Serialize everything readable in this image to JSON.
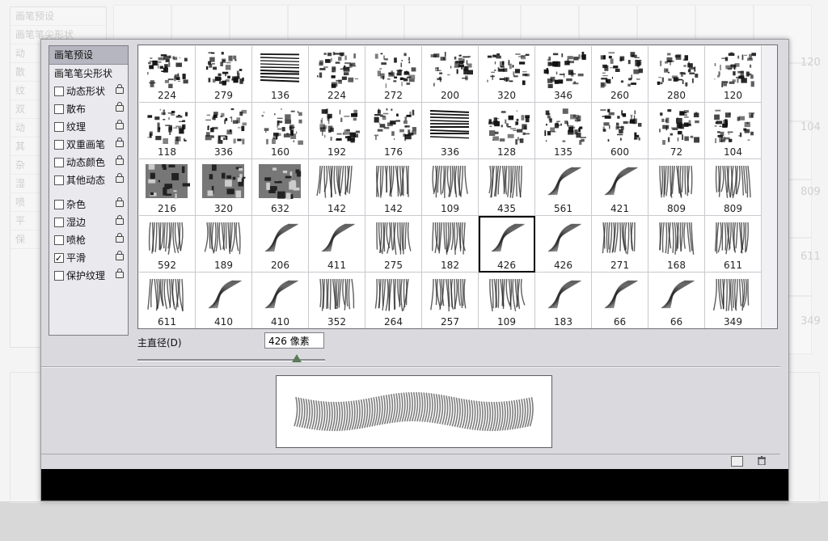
{
  "background": {
    "side_items": [
      "画笔预设",
      "画笔笔尖形状",
      "动",
      "散",
      "纹",
      "双",
      "动",
      "其",
      "杂",
      "湿",
      "喷",
      "平",
      "保"
    ],
    "right_numbers": [
      "120",
      "104",
      "809",
      "611",
      "349"
    ]
  },
  "sidebar": {
    "header": "画笔预设",
    "tip_shape": "画笔笔尖形状",
    "items": [
      {
        "label": "动态形状",
        "checked": false,
        "locked": true
      },
      {
        "label": "散布",
        "checked": false,
        "locked": true
      },
      {
        "label": "纹理",
        "checked": false,
        "locked": true
      },
      {
        "label": "双重画笔",
        "checked": false,
        "locked": true
      },
      {
        "label": "动态颜色",
        "checked": false,
        "locked": true
      },
      {
        "label": "其他动态",
        "checked": false,
        "locked": true
      },
      {
        "label": "杂色",
        "checked": false,
        "locked": true
      },
      {
        "label": "湿边",
        "checked": false,
        "locked": true
      },
      {
        "label": "喷枪",
        "checked": false,
        "locked": true
      },
      {
        "label": "平滑",
        "checked": true,
        "locked": true
      },
      {
        "label": "保护纹理",
        "checked": false,
        "locked": true
      }
    ]
  },
  "brush_grid": {
    "rows": [
      [
        {
          "size": "224",
          "kind": "grunge"
        },
        {
          "size": "279",
          "kind": "grunge"
        },
        {
          "size": "136",
          "kind": "lines"
        },
        {
          "size": "224",
          "kind": "grunge"
        },
        {
          "size": "272",
          "kind": "grunge"
        },
        {
          "size": "200",
          "kind": "grunge"
        },
        {
          "size": "320",
          "kind": "grunge"
        },
        {
          "size": "346",
          "kind": "grunge"
        },
        {
          "size": "260",
          "kind": "grunge"
        },
        {
          "size": "280",
          "kind": "grunge"
        },
        {
          "size": "120",
          "kind": "grunge"
        }
      ],
      [
        {
          "size": "118",
          "kind": "grunge"
        },
        {
          "size": "336",
          "kind": "grunge"
        },
        {
          "size": "160",
          "kind": "grunge"
        },
        {
          "size": "192",
          "kind": "grunge"
        },
        {
          "size": "176",
          "kind": "grunge"
        },
        {
          "size": "336",
          "kind": "lines"
        },
        {
          "size": "128",
          "kind": "grunge"
        },
        {
          "size": "135",
          "kind": "grunge"
        },
        {
          "size": "600",
          "kind": "grunge"
        },
        {
          "size": "72",
          "kind": "grunge"
        },
        {
          "size": "104",
          "kind": "grunge"
        }
      ],
      [
        {
          "size": "216",
          "kind": "photo"
        },
        {
          "size": "320",
          "kind": "photo"
        },
        {
          "size": "632",
          "kind": "photo"
        },
        {
          "size": "142",
          "kind": "hair"
        },
        {
          "size": "142",
          "kind": "hair"
        },
        {
          "size": "109",
          "kind": "hair"
        },
        {
          "size": "435",
          "kind": "hair"
        },
        {
          "size": "561",
          "kind": "curl"
        },
        {
          "size": "421",
          "kind": "curl"
        },
        {
          "size": "809",
          "kind": "hair"
        },
        {
          "size": "809",
          "kind": "hair"
        }
      ],
      [
        {
          "size": "592",
          "kind": "hair"
        },
        {
          "size": "189",
          "kind": "hair"
        },
        {
          "size": "206",
          "kind": "curl"
        },
        {
          "size": "411",
          "kind": "curl"
        },
        {
          "size": "275",
          "kind": "hair"
        },
        {
          "size": "182",
          "kind": "hair"
        },
        {
          "size": "426",
          "kind": "curl",
          "selected": true
        },
        {
          "size": "426",
          "kind": "curl"
        },
        {
          "size": "271",
          "kind": "hair"
        },
        {
          "size": "168",
          "kind": "hair"
        },
        {
          "size": "611",
          "kind": "hair"
        }
      ],
      [
        {
          "size": "611",
          "kind": "hair"
        },
        {
          "size": "410",
          "kind": "curl"
        },
        {
          "size": "410",
          "kind": "curl"
        },
        {
          "size": "352",
          "kind": "hair"
        },
        {
          "size": "264",
          "kind": "hair"
        },
        {
          "size": "257",
          "kind": "hair"
        },
        {
          "size": "109",
          "kind": "hair"
        },
        {
          "size": "183",
          "kind": "curl"
        },
        {
          "size": "66",
          "kind": "curl"
        },
        {
          "size": "66",
          "kind": "curl"
        },
        {
          "size": "349",
          "kind": "hair"
        }
      ]
    ]
  },
  "diameter": {
    "label": "主直径(D)",
    "value": "426 像素",
    "slider_fraction": 0.85
  },
  "icons": {
    "new_brush": "new-brush-icon",
    "delete": "trash-icon",
    "scroll_up": "▲",
    "scroll_down": "▼"
  }
}
